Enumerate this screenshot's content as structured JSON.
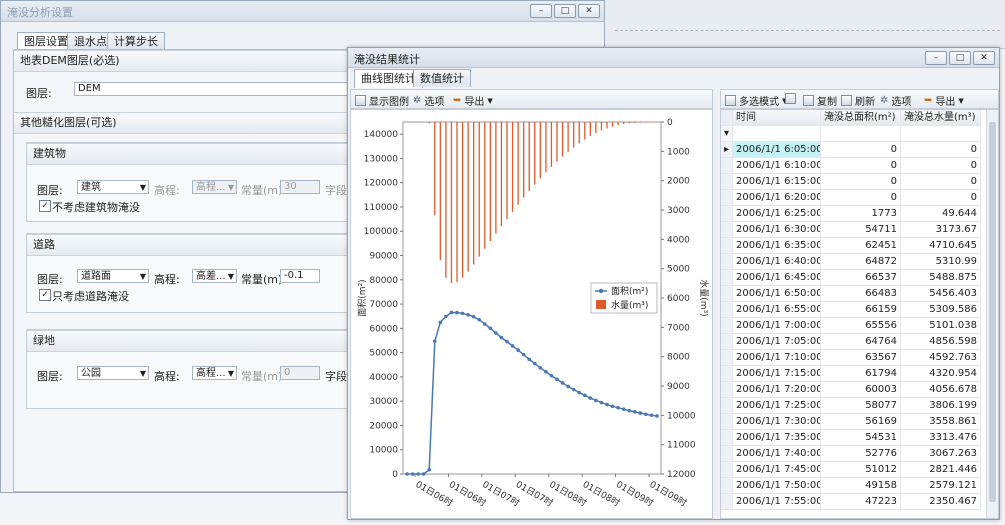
{
  "left_window": {
    "title": "淹没分析设置",
    "tabs": [
      "图层设置",
      "退水点",
      "计算步长"
    ],
    "dem_section": "地表DEM图层(必选)",
    "layer_label": "图层:",
    "dem_value": "DEM",
    "other_section": "其他糙化图层(可选)",
    "buildings": {
      "title": "建筑物",
      "layer_label": "图层:",
      "layer_value": "建筑",
      "height_label": "高程:",
      "height_value": "高程...",
      "const_label": "常量(m):",
      "const_value": "30",
      "field_label": "字段:",
      "check_label": "不考虑建筑物淹没",
      "checked": true
    },
    "roads": {
      "title": "道路",
      "layer_label": "图层:",
      "layer_value": "道路面",
      "height_label": "高程:",
      "height_value": "高差...",
      "const_label": "常量(m):",
      "const_value": "-0.1",
      "check_label": "只考虑道路淹没",
      "checked": true
    },
    "green": {
      "title": "绿地",
      "layer_label": "图层:",
      "layer_value": "公园",
      "height_label": "高程:",
      "height_value": "高程...",
      "const_label": "常量(m):",
      "const_value": "0",
      "field_label": "字段:"
    }
  },
  "result_window": {
    "title": "淹没结果统计",
    "tabs": [
      "曲线图统计",
      "数值统计"
    ],
    "chart_toolbar": {
      "show_legend": "显示图例",
      "options": "选项",
      "export": "导出"
    },
    "grid_toolbar": {
      "multiselect": "多选模式",
      "copy": "复制",
      "refresh": "刷新",
      "options": "选项",
      "export": "导出"
    },
    "columns": [
      "时间",
      "淹没总面积(m²)",
      "淹没总水量(m³)"
    ],
    "rows": [
      [
        "2006/1/1 6:05:00",
        "0",
        "0"
      ],
      [
        "2006/1/1 6:10:00",
        "0",
        "0"
      ],
      [
        "2006/1/1 6:15:00",
        "0",
        "0"
      ],
      [
        "2006/1/1 6:20:00",
        "0",
        "0"
      ],
      [
        "2006/1/1 6:25:00",
        "1773",
        "49.644"
      ],
      [
        "2006/1/1 6:30:00",
        "54711",
        "3173.67"
      ],
      [
        "2006/1/1 6:35:00",
        "62451",
        "4710.645"
      ],
      [
        "2006/1/1 6:40:00",
        "64872",
        "5310.99"
      ],
      [
        "2006/1/1 6:45:00",
        "66537",
        "5488.875"
      ],
      [
        "2006/1/1 6:50:00",
        "66483",
        "5456.403"
      ],
      [
        "2006/1/1 6:55:00",
        "66159",
        "5309.586"
      ],
      [
        "2006/1/1 7:00:00",
        "65556",
        "5101.038"
      ],
      [
        "2006/1/1 7:05:00",
        "64764",
        "4856.598"
      ],
      [
        "2006/1/1 7:10:00",
        "63567",
        "4592.763"
      ],
      [
        "2006/1/1 7:15:00",
        "61794",
        "4320.954"
      ],
      [
        "2006/1/1 7:20:00",
        "60003",
        "4056.678"
      ],
      [
        "2006/1/1 7:25:00",
        "58077",
        "3806.199"
      ],
      [
        "2006/1/1 7:30:00",
        "56169",
        "3558.861"
      ],
      [
        "2006/1/1 7:35:00",
        "54531",
        "3313.476"
      ],
      [
        "2006/1/1 7:40:00",
        "52776",
        "3067.263"
      ],
      [
        "2006/1/1 7:45:00",
        "51012",
        "2821.446"
      ],
      [
        "2006/1/1 7:50:00",
        "49158",
        "2579.121"
      ],
      [
        "2006/1/1 7:55:00",
        "47223",
        "2350.467"
      ]
    ]
  },
  "chart_data": {
    "type": "line",
    "ylabel": "面积(m²)",
    "y2label": "水量(m³)",
    "ylim": [
      0,
      145000
    ],
    "y2lim": [
      0,
      12000
    ],
    "y2_inverted": true,
    "yticks": [
      "0",
      "10000",
      "20000",
      "30000",
      "40000",
      "50000",
      "60000",
      "70000",
      "80000",
      "90000",
      "100000",
      "110000",
      "120000",
      "130000",
      "140000"
    ],
    "y2ticks": [
      "0",
      "1000",
      "2000",
      "3000",
      "4000",
      "5000",
      "6000",
      "7000",
      "8000",
      "9000",
      "10000",
      "11000",
      "12000"
    ],
    "xticks": [
      "01日06时",
      "01日06时",
      "01日07时",
      "01日07时",
      "01日08时",
      "01日08时",
      "01日09时",
      "01日09时"
    ],
    "legend": [
      "面积(m²)",
      "水量(m³)"
    ],
    "legend_position": "right",
    "series": [
      {
        "name": "面积(m²)",
        "type": "line",
        "color": "#4a78b5",
        "values": [
          0,
          0,
          0,
          0,
          1773,
          54711,
          62451,
          64872,
          66537,
          66483,
          66159,
          65556,
          64764,
          63567,
          61794,
          60003,
          58077,
          56169,
          54531,
          52776,
          51012,
          49158,
          47223,
          45500,
          43700,
          42100,
          40500,
          39000,
          37500,
          36100,
          34800,
          33500,
          32400,
          31300,
          30300,
          29400,
          28600,
          27900,
          27300,
          26700,
          26100,
          25600,
          25100,
          24600,
          24200,
          23900
        ]
      },
      {
        "name": "水量(m³)",
        "type": "bar",
        "color": "#e05a2b",
        "values": [
          0,
          0,
          0,
          0,
          49.644,
          3173.67,
          4710.645,
          5310.99,
          5488.875,
          5456.403,
          5309.586,
          5101.038,
          4856.598,
          4592.763,
          4320.954,
          4056.678,
          3806.199,
          3558.861,
          3313.476,
          3067.263,
          2821.446,
          2579.121,
          2350.467,
          2130,
          1920,
          1720,
          1530,
          1350,
          1180,
          1020,
          870,
          730,
          600,
          480,
          380,
          290,
          220,
          160,
          110,
          75,
          50,
          30,
          20,
          12,
          8,
          5
        ]
      }
    ]
  }
}
